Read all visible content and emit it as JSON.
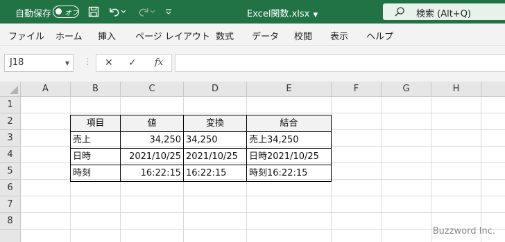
{
  "titlebar": {
    "autosave_label": "自動保存",
    "autosave_state": "オフ",
    "filename": "Excel関数.xlsx",
    "search_placeholder": "検索 (Alt+Q)"
  },
  "menu": [
    "ファイル",
    "ホーム",
    "挿入",
    "ページ レイアウト",
    "数式",
    "データ",
    "校閲",
    "表示",
    "ヘルプ"
  ],
  "formula_bar": {
    "name_box": "J18",
    "formula": ""
  },
  "columns": [
    "A",
    "B",
    "C",
    "D",
    "E",
    "F",
    "G",
    "H"
  ],
  "rows": [
    "1",
    "2",
    "3",
    "4",
    "5",
    "6",
    "7",
    "8"
  ],
  "table": {
    "headers": [
      "項目",
      "値",
      "変換",
      "結合"
    ],
    "rows": [
      [
        "売上",
        "34,250",
        "34,250",
        "売上34,250"
      ],
      [
        "日時",
        "2021/10/25",
        "2021/10/25",
        "日時2021/10/25"
      ],
      [
        "時刻",
        "16:22:15",
        "16:22:15",
        "時刻16:22:15"
      ]
    ]
  },
  "watermark": "Buzzword Inc.",
  "colors": {
    "titlebar": "#217346",
    "ribbon": "#f3f3f3",
    "header_fill": "#e6e6e6",
    "table_header_fill": "#f2f2f2"
  }
}
